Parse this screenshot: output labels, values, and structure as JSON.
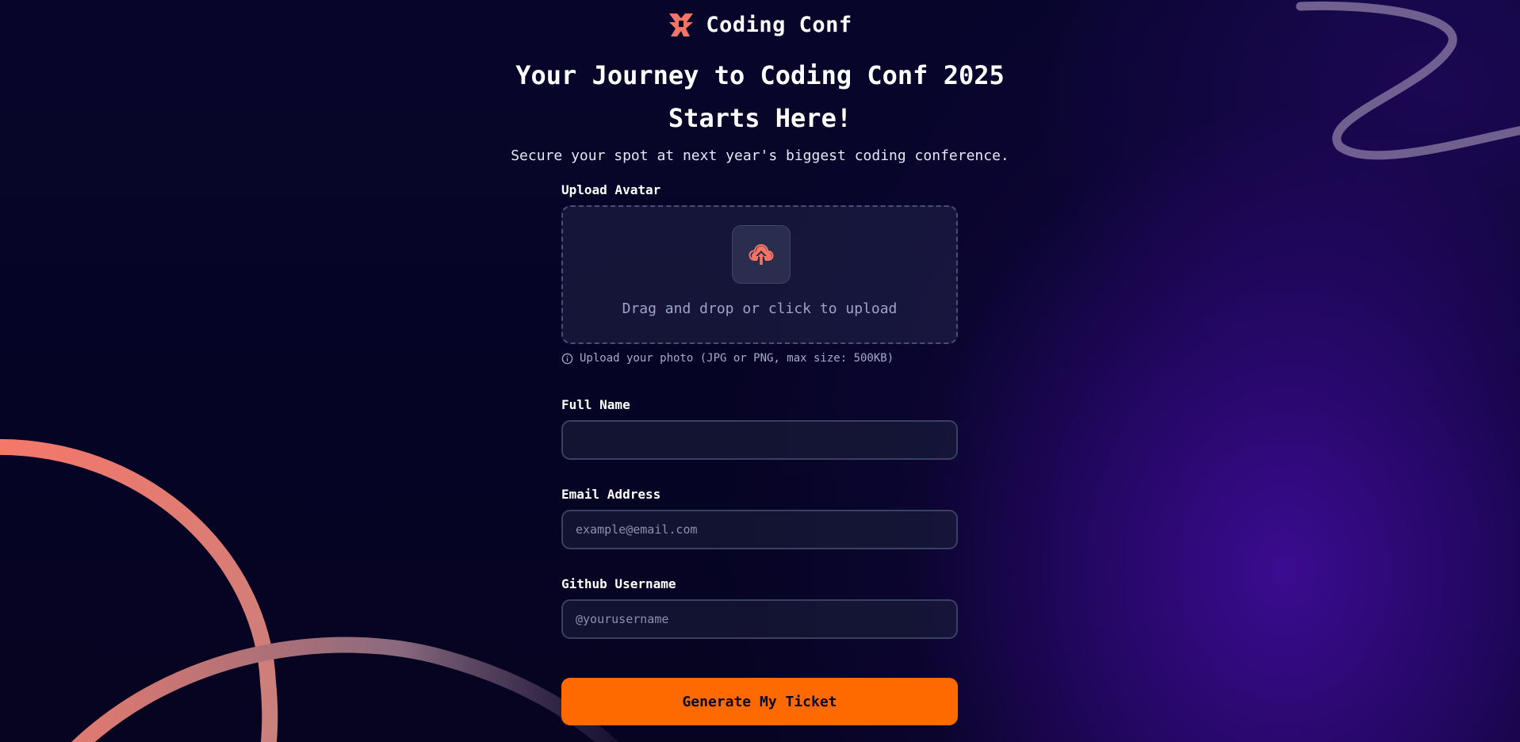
{
  "brand": {
    "name": "Coding Conf",
    "logo_icon": "coding-conf-logo-icon",
    "accent_color": "#f57463"
  },
  "hero": {
    "headline_line1": "Your Journey to Coding Conf 2025",
    "headline_line2": "Starts Here!",
    "subtitle": "Secure your spot at next year's biggest coding conference."
  },
  "form": {
    "avatar": {
      "label": "Upload Avatar",
      "dropzone_text": "Drag and drop or click to upload",
      "icon": "cloud-upload-icon",
      "hint": "Upload your photo (JPG or PNG, max size: 500KB)",
      "hint_icon": "info-icon"
    },
    "full_name": {
      "label": "Full Name",
      "value": "",
      "placeholder": ""
    },
    "email": {
      "label": "Email Address",
      "value": "",
      "placeholder": "example@email.com"
    },
    "github": {
      "label": "Github Username",
      "value": "",
      "placeholder": "@yourusername"
    },
    "submit_label": "Generate My Ticket",
    "submit_color": "#fe6a00"
  }
}
